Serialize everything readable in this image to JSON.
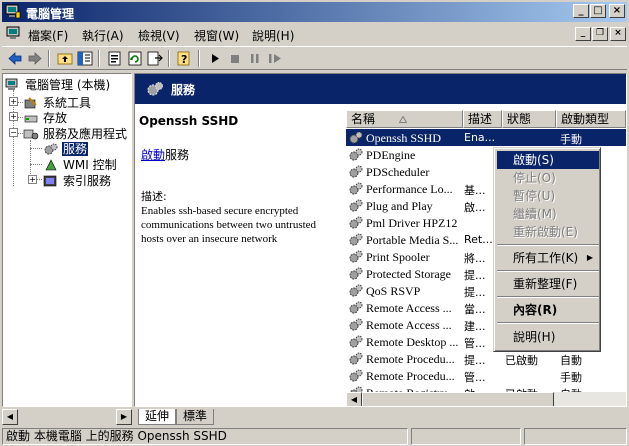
{
  "window": {
    "title": "電腦管理",
    "min_label": "_",
    "max_label": "□",
    "close_label": "×"
  },
  "menu": {
    "items": [
      "檔案(F)",
      "執行(A)",
      "檢視(V)",
      "視窗(W)",
      "說明(H)"
    ],
    "mdi_min": "_",
    "mdi_restore": "❐",
    "mdi_close": "×"
  },
  "tree": {
    "root": "電腦管理 (本機)",
    "nodes": [
      "系統工具",
      "存放",
      "服務及應用程式",
      "服務",
      "WMI 控制",
      "索引服務"
    ]
  },
  "header": {
    "title": "服務"
  },
  "details": {
    "service_name": "Openssh SSHD",
    "start_link": "啟動",
    "start_suffix": "服務",
    "desc_label": "描述:",
    "desc_text": "Enables ssh-based secure encrypted communications between two untrusted hosts over an insecure network"
  },
  "columns": {
    "name": "名稱",
    "desc": "描述",
    "status": "狀態",
    "type": "啟動類型",
    "sort_icon": "sort-ascending-icon"
  },
  "services": [
    {
      "name": "Openssh SSHD",
      "desc": "Ena...",
      "status": "",
      "type": "手動"
    },
    {
      "name": "PDEngine",
      "desc": "",
      "status": "",
      "type": ""
    },
    {
      "name": "PDScheduler",
      "desc": "",
      "status": "",
      "type": ""
    },
    {
      "name": "Performance Lo...",
      "desc": "基...",
      "status": "",
      "type": ""
    },
    {
      "name": "Plug and Play",
      "desc": "啟...",
      "status": "",
      "type": ""
    },
    {
      "name": "Pml Driver HPZ12",
      "desc": "",
      "status": "",
      "type": ""
    },
    {
      "name": "Portable Media S...",
      "desc": "Ret...",
      "status": "",
      "type": ""
    },
    {
      "name": "Print Spooler",
      "desc": "將...",
      "status": "",
      "type": ""
    },
    {
      "name": "Protected Storage",
      "desc": "提...",
      "status": "",
      "type": ""
    },
    {
      "name": "QoS RSVP",
      "desc": "提...",
      "status": "",
      "type": ""
    },
    {
      "name": "Remote Access ...",
      "desc": "當...",
      "status": "",
      "type": ""
    },
    {
      "name": "Remote Access ...",
      "desc": "建...",
      "status": "",
      "type": ""
    },
    {
      "name": "Remote Desktop ...",
      "desc": "管...",
      "status": "",
      "type": ""
    },
    {
      "name": "Remote Procedu...",
      "desc": "提...",
      "status": "已啟動",
      "type": "自動"
    },
    {
      "name": "Remote Procedu...",
      "desc": "管...",
      "status": "",
      "type": "手動"
    },
    {
      "name": "Remote Registry",
      "desc": "啟...",
      "status": "已啟動",
      "type": "自動"
    }
  ],
  "context_menu": {
    "start": "啟動(S)",
    "stop": "停止(O)",
    "pause": "暫停(U)",
    "resume": "繼續(M)",
    "restart": "重新啟動(E)",
    "all_tasks": "所有工作(K)",
    "refresh": "重新整理(F)",
    "properties": "內容(R)",
    "help": "說明(H)"
  },
  "tabs": {
    "extended": "延伸",
    "standard": "標準"
  },
  "status": {
    "text": "啟動 本機電腦 上的服務 Openssh SSHD"
  },
  "colors": {
    "titlebar": "#0a246a",
    "selection": "#0a246a",
    "face": "#d4d0c8"
  }
}
